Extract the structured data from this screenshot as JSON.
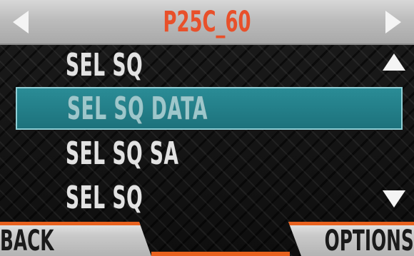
{
  "header": {
    "title": "P25C_60",
    "title_color": "#e8502a",
    "prev_icon": "triangle-left-icon",
    "next_icon": "triangle-right-icon"
  },
  "list": {
    "items": [
      {
        "label": "SEL SQ",
        "selected": false
      },
      {
        "label": "SEL SQ DATA",
        "selected": true
      },
      {
        "label": "SEL SQ SA",
        "selected": false
      },
      {
        "label": "SEL SQ",
        "selected": false
      }
    ],
    "scroll_up_icon": "triangle-up-icon",
    "scroll_down_icon": "triangle-down-icon",
    "selected_color": "#2a8c96"
  },
  "footer": {
    "back_label": "BACK",
    "options_label": "OPTIONS",
    "accent_color": "#e8611e"
  }
}
